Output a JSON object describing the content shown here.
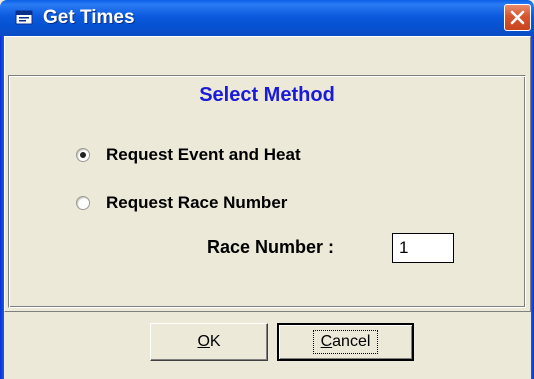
{
  "window": {
    "title": "Get Times",
    "app_icon": "window-app-icon",
    "close_icon": "close-icon"
  },
  "main": {
    "section_title": "Select Method",
    "options": [
      {
        "label": "Request Event and Heat",
        "checked": true
      },
      {
        "label": "Request Race Number",
        "checked": false
      }
    ],
    "race_number_label": "Race Number :",
    "race_number_value": "1"
  },
  "buttons": {
    "ok_mnemonic": "O",
    "ok_rest": "K",
    "cancel_mnemonic": "C",
    "cancel_rest": "ancel"
  },
  "colors": {
    "title_bar": "#0552d2",
    "section_title": "#1a1ad9",
    "close_button": "#d6552f",
    "background": "#ece9d8"
  }
}
